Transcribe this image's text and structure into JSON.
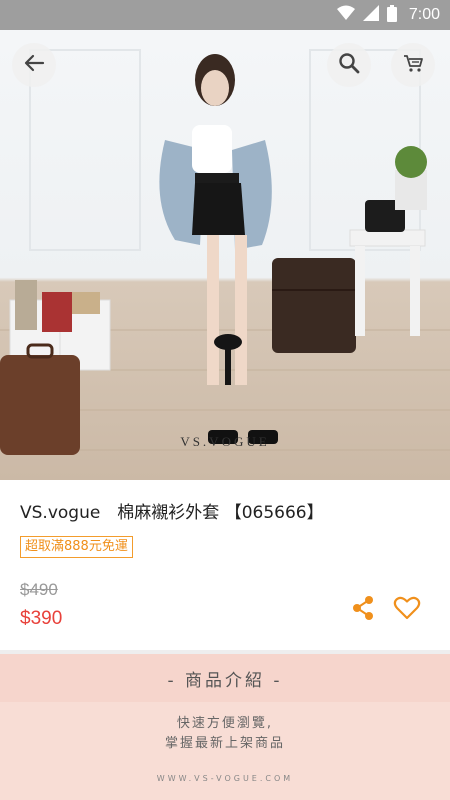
{
  "status_bar": {
    "time": "7:00"
  },
  "hero": {
    "watermark": "VS.VOGUE"
  },
  "product": {
    "title": "VS.vogue　棉麻襯衫外套 【065666】",
    "promo": "超取滿888元免運",
    "price_original": "$490",
    "price_sale": "$390"
  },
  "intro": {
    "header": "- 商品介紹 -",
    "line1": "快速方便瀏覽,",
    "line2": "掌握最新上架商品",
    "site": "WWW.VS-VOGUE.COM"
  },
  "colors": {
    "accent": "#f0901c",
    "sale": "#e8413a",
    "intro_bg": "#f6d5cc"
  },
  "icons": [
    "wifi-icon",
    "signal-icon",
    "battery-icon",
    "back-arrow-icon",
    "search-icon",
    "cart-icon",
    "share-icon",
    "heart-icon"
  ]
}
